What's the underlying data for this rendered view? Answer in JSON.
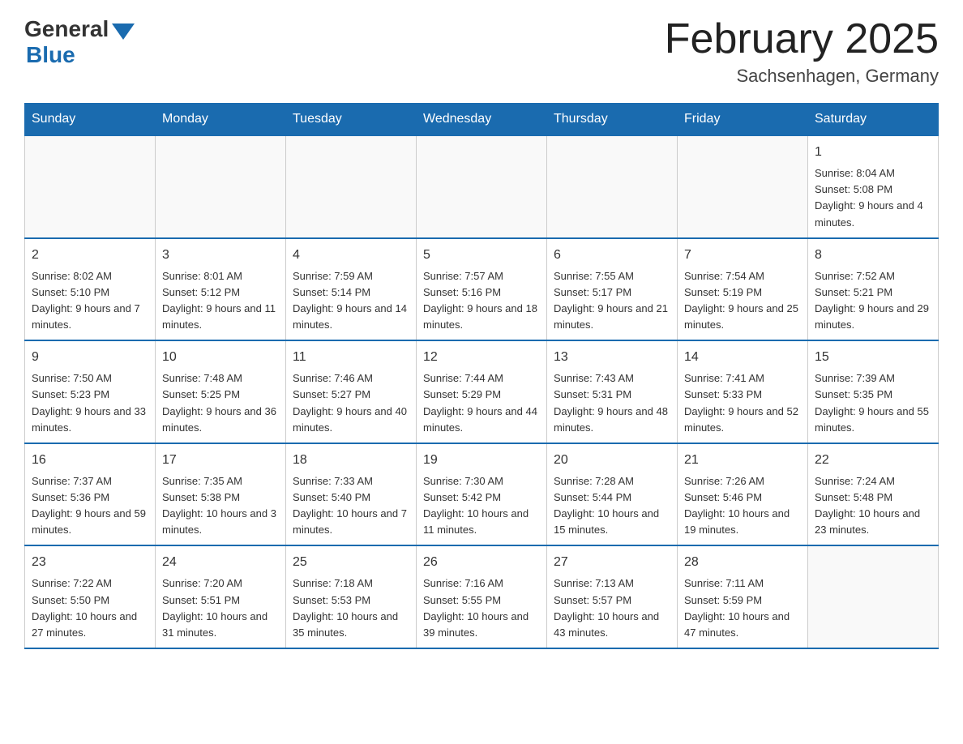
{
  "header": {
    "logo_general": "General",
    "logo_blue": "Blue",
    "month_title": "February 2025",
    "location": "Sachsenhagen, Germany"
  },
  "weekdays": [
    "Sunday",
    "Monday",
    "Tuesday",
    "Wednesday",
    "Thursday",
    "Friday",
    "Saturday"
  ],
  "weeks": [
    [
      {
        "day": "",
        "info": ""
      },
      {
        "day": "",
        "info": ""
      },
      {
        "day": "",
        "info": ""
      },
      {
        "day": "",
        "info": ""
      },
      {
        "day": "",
        "info": ""
      },
      {
        "day": "",
        "info": ""
      },
      {
        "day": "1",
        "info": "Sunrise: 8:04 AM\nSunset: 5:08 PM\nDaylight: 9 hours and 4 minutes."
      }
    ],
    [
      {
        "day": "2",
        "info": "Sunrise: 8:02 AM\nSunset: 5:10 PM\nDaylight: 9 hours and 7 minutes."
      },
      {
        "day": "3",
        "info": "Sunrise: 8:01 AM\nSunset: 5:12 PM\nDaylight: 9 hours and 11 minutes."
      },
      {
        "day": "4",
        "info": "Sunrise: 7:59 AM\nSunset: 5:14 PM\nDaylight: 9 hours and 14 minutes."
      },
      {
        "day": "5",
        "info": "Sunrise: 7:57 AM\nSunset: 5:16 PM\nDaylight: 9 hours and 18 minutes."
      },
      {
        "day": "6",
        "info": "Sunrise: 7:55 AM\nSunset: 5:17 PM\nDaylight: 9 hours and 21 minutes."
      },
      {
        "day": "7",
        "info": "Sunrise: 7:54 AM\nSunset: 5:19 PM\nDaylight: 9 hours and 25 minutes."
      },
      {
        "day": "8",
        "info": "Sunrise: 7:52 AM\nSunset: 5:21 PM\nDaylight: 9 hours and 29 minutes."
      }
    ],
    [
      {
        "day": "9",
        "info": "Sunrise: 7:50 AM\nSunset: 5:23 PM\nDaylight: 9 hours and 33 minutes."
      },
      {
        "day": "10",
        "info": "Sunrise: 7:48 AM\nSunset: 5:25 PM\nDaylight: 9 hours and 36 minutes."
      },
      {
        "day": "11",
        "info": "Sunrise: 7:46 AM\nSunset: 5:27 PM\nDaylight: 9 hours and 40 minutes."
      },
      {
        "day": "12",
        "info": "Sunrise: 7:44 AM\nSunset: 5:29 PM\nDaylight: 9 hours and 44 minutes."
      },
      {
        "day": "13",
        "info": "Sunrise: 7:43 AM\nSunset: 5:31 PM\nDaylight: 9 hours and 48 minutes."
      },
      {
        "day": "14",
        "info": "Sunrise: 7:41 AM\nSunset: 5:33 PM\nDaylight: 9 hours and 52 minutes."
      },
      {
        "day": "15",
        "info": "Sunrise: 7:39 AM\nSunset: 5:35 PM\nDaylight: 9 hours and 55 minutes."
      }
    ],
    [
      {
        "day": "16",
        "info": "Sunrise: 7:37 AM\nSunset: 5:36 PM\nDaylight: 9 hours and 59 minutes."
      },
      {
        "day": "17",
        "info": "Sunrise: 7:35 AM\nSunset: 5:38 PM\nDaylight: 10 hours and 3 minutes."
      },
      {
        "day": "18",
        "info": "Sunrise: 7:33 AM\nSunset: 5:40 PM\nDaylight: 10 hours and 7 minutes."
      },
      {
        "day": "19",
        "info": "Sunrise: 7:30 AM\nSunset: 5:42 PM\nDaylight: 10 hours and 11 minutes."
      },
      {
        "day": "20",
        "info": "Sunrise: 7:28 AM\nSunset: 5:44 PM\nDaylight: 10 hours and 15 minutes."
      },
      {
        "day": "21",
        "info": "Sunrise: 7:26 AM\nSunset: 5:46 PM\nDaylight: 10 hours and 19 minutes."
      },
      {
        "day": "22",
        "info": "Sunrise: 7:24 AM\nSunset: 5:48 PM\nDaylight: 10 hours and 23 minutes."
      }
    ],
    [
      {
        "day": "23",
        "info": "Sunrise: 7:22 AM\nSunset: 5:50 PM\nDaylight: 10 hours and 27 minutes."
      },
      {
        "day": "24",
        "info": "Sunrise: 7:20 AM\nSunset: 5:51 PM\nDaylight: 10 hours and 31 minutes."
      },
      {
        "day": "25",
        "info": "Sunrise: 7:18 AM\nSunset: 5:53 PM\nDaylight: 10 hours and 35 minutes."
      },
      {
        "day": "26",
        "info": "Sunrise: 7:16 AM\nSunset: 5:55 PM\nDaylight: 10 hours and 39 minutes."
      },
      {
        "day": "27",
        "info": "Sunrise: 7:13 AM\nSunset: 5:57 PM\nDaylight: 10 hours and 43 minutes."
      },
      {
        "day": "28",
        "info": "Sunrise: 7:11 AM\nSunset: 5:59 PM\nDaylight: 10 hours and 47 minutes."
      },
      {
        "day": "",
        "info": ""
      }
    ]
  ]
}
